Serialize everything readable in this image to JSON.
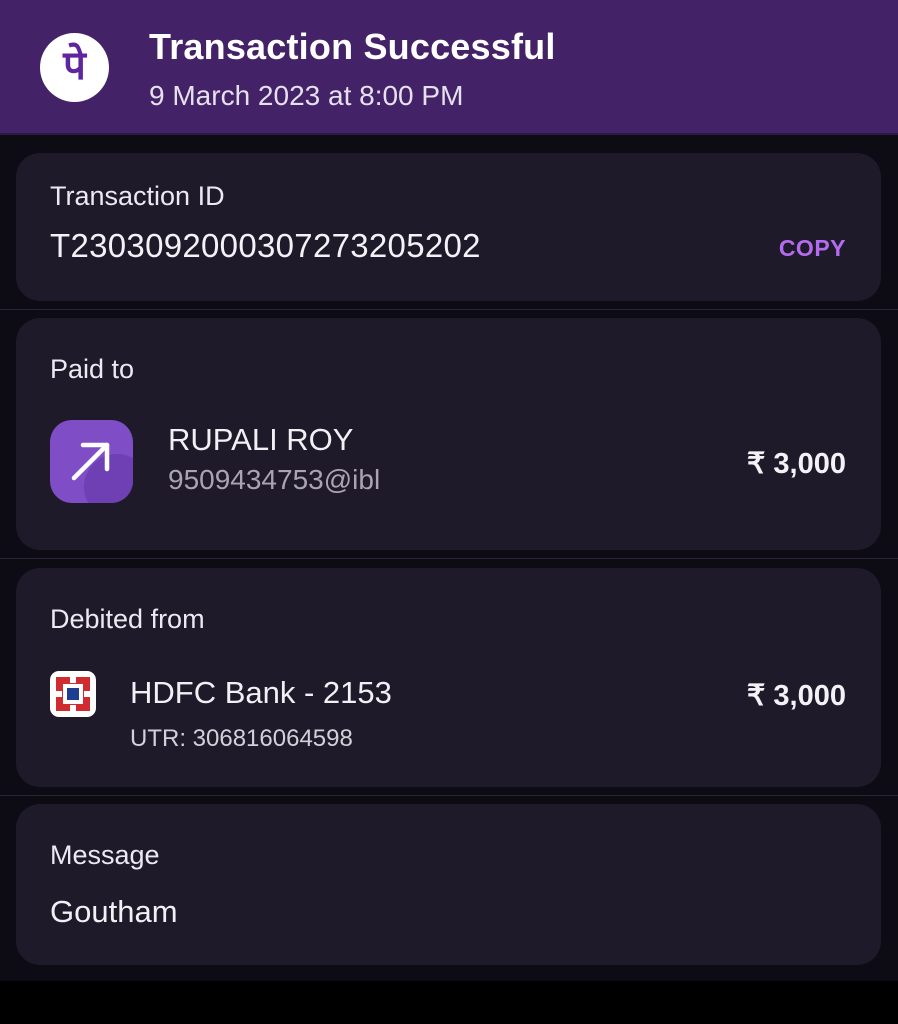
{
  "header": {
    "logo_glyph": "पे",
    "title": "Transaction Successful",
    "datetime": "9 March 2023 at 8:00 PM"
  },
  "transaction": {
    "label": "Transaction ID",
    "id": "T2303092000307273205202",
    "copy_label": "COPY"
  },
  "paid_to": {
    "label": "Paid to",
    "icon": "arrow-up-right-icon",
    "name": "RUPALI ROY",
    "upi_id": "9509434753@ibl",
    "amount": "₹ 3,000"
  },
  "debited_from": {
    "label": "Debited from",
    "icon": "hdfc-bank-logo",
    "bank": "HDFC Bank - 2153",
    "utr": "UTR: 306816064598",
    "amount": "₹ 3,000"
  },
  "message": {
    "label": "Message",
    "text": "Goutham"
  },
  "colors": {
    "header_bg": "#432267",
    "card_bg": "#1f1a2a",
    "accent": "#b36cf0",
    "payee_icon_bg": "#7f4ec7",
    "hdfc_red": "#d02c2f",
    "hdfc_blue": "#1e3f8f"
  }
}
